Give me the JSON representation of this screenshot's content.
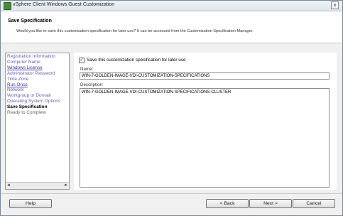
{
  "window": {
    "title": "vSphere Client Windows Guest Customization",
    "close_label": "×"
  },
  "header": {
    "step_title": "Save Specification",
    "step_description": "Would you like to save this customization specification for later use? It can be accessed from the Customization Specification Manager."
  },
  "nav": {
    "items": [
      {
        "label": "Registration Information",
        "state": "visited"
      },
      {
        "label": "Computer Name",
        "state": "visited"
      },
      {
        "label": "Windows License",
        "state": "link"
      },
      {
        "label": "Administrator Password",
        "state": "visited"
      },
      {
        "label": "Time Zone",
        "state": "visited"
      },
      {
        "label": "Run Once",
        "state": "link"
      },
      {
        "label": "Network",
        "state": "visited"
      },
      {
        "label": "Workgroup or Domain",
        "state": "visited"
      },
      {
        "label": "Operating System Options",
        "state": "visited"
      },
      {
        "label": "Save Specification",
        "state": "current"
      },
      {
        "label": "Ready to Complete",
        "state": "future"
      }
    ],
    "scroll_left": "◄",
    "scroll_right": "►"
  },
  "form": {
    "save_checked": true,
    "check_mark": "✓",
    "save_label": "Save this customization specification for later use",
    "name_label": "Name:",
    "name_value": "WIN-7-GOLDEN-IMAGE-VDI-CUSTOMIZATION-SPECIFICATIONS",
    "description_label": "Description:",
    "description_value": "WIN-7-GOLDEN-IMAGE-VDI-CUSTOMIZATION-SPECIFICATIONS-CLUSTER"
  },
  "buttons": {
    "help": "Help",
    "back": "< Back",
    "next": "Next >",
    "cancel": "Cancel"
  }
}
